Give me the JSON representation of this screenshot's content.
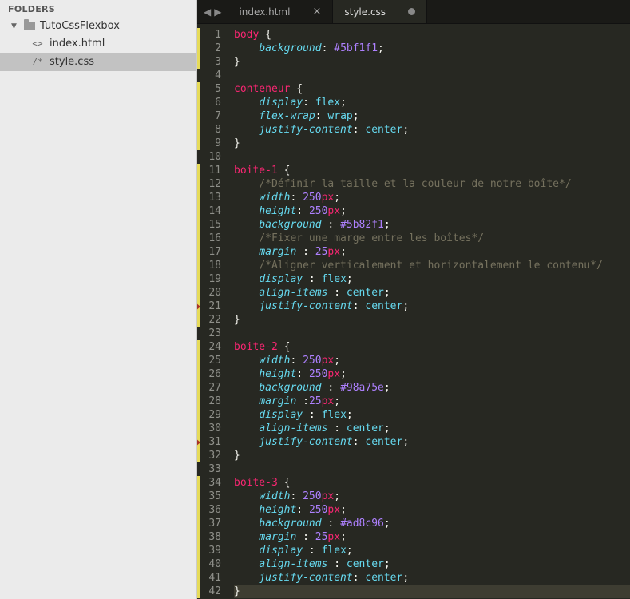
{
  "sidebar": {
    "header": "FOLDERS",
    "folder": "TutoCssFlexbox",
    "files": [
      {
        "icon": "<>",
        "name": "index.html",
        "selected": false
      },
      {
        "icon": "/*",
        "name": "style.css",
        "selected": true
      }
    ]
  },
  "tabs": [
    {
      "label": "index.html",
      "active": false,
      "dirty": false
    },
    {
      "label": "style.css",
      "active": true,
      "dirty": true
    }
  ],
  "code": {
    "lines": [
      {
        "n": 1,
        "m": true,
        "t": [
          [
            "sel",
            "body"
          ],
          [
            "punc",
            " {"
          ]
        ]
      },
      {
        "n": 2,
        "m": true,
        "t": [
          [
            "",
            "    "
          ],
          [
            "prop",
            "background"
          ],
          [
            "punc",
            ": "
          ],
          [
            "hex",
            "#5bf1f1"
          ],
          [
            "punc",
            ";"
          ]
        ]
      },
      {
        "n": 3,
        "m": true,
        "t": [
          [
            "punc",
            "}"
          ]
        ]
      },
      {
        "n": 4,
        "t": []
      },
      {
        "n": 5,
        "m": true,
        "t": [
          [
            "sel",
            "conteneur"
          ],
          [
            "punc",
            " {"
          ]
        ]
      },
      {
        "n": 6,
        "m": true,
        "t": [
          [
            "",
            "    "
          ],
          [
            "prop",
            "display"
          ],
          [
            "punc",
            ": "
          ],
          [
            "val",
            "flex"
          ],
          [
            "punc",
            ";"
          ]
        ]
      },
      {
        "n": 7,
        "m": true,
        "t": [
          [
            "",
            "    "
          ],
          [
            "prop",
            "flex-wrap"
          ],
          [
            "punc",
            ": "
          ],
          [
            "val",
            "wrap"
          ],
          [
            "punc",
            ";"
          ]
        ]
      },
      {
        "n": 8,
        "m": true,
        "t": [
          [
            "",
            "    "
          ],
          [
            "prop",
            "justify-content"
          ],
          [
            "punc",
            ": "
          ],
          [
            "val",
            "center"
          ],
          [
            "punc",
            ";"
          ]
        ]
      },
      {
        "n": 9,
        "m": true,
        "t": [
          [
            "punc",
            "}"
          ]
        ]
      },
      {
        "n": 10,
        "t": []
      },
      {
        "n": 11,
        "m": true,
        "t": [
          [
            "sel",
            "boite-1"
          ],
          [
            "punc",
            " {"
          ]
        ]
      },
      {
        "n": 12,
        "m": true,
        "t": [
          [
            "",
            "    "
          ],
          [
            "com",
            "/*Définir la taille et la couleur de notre boîte*/"
          ]
        ]
      },
      {
        "n": 13,
        "m": true,
        "t": [
          [
            "",
            "    "
          ],
          [
            "prop",
            "width"
          ],
          [
            "punc",
            ": "
          ],
          [
            "num",
            "250"
          ],
          [
            "unit",
            "px"
          ],
          [
            "punc",
            ";"
          ]
        ]
      },
      {
        "n": 14,
        "m": true,
        "t": [
          [
            "",
            "    "
          ],
          [
            "prop",
            "height"
          ],
          [
            "punc",
            ": "
          ],
          [
            "num",
            "250"
          ],
          [
            "unit",
            "px"
          ],
          [
            "punc",
            ";"
          ]
        ]
      },
      {
        "n": 15,
        "m": true,
        "t": [
          [
            "",
            "    "
          ],
          [
            "prop",
            "background"
          ],
          [
            "punc",
            " : "
          ],
          [
            "hex",
            "#5b82f1"
          ],
          [
            "punc",
            ";"
          ]
        ]
      },
      {
        "n": 16,
        "m": true,
        "t": [
          [
            "",
            "    "
          ],
          [
            "com",
            "/*Fixer une marge entre les boîtes*/"
          ]
        ]
      },
      {
        "n": 17,
        "m": true,
        "t": [
          [
            "",
            "    "
          ],
          [
            "prop",
            "margin"
          ],
          [
            "punc",
            " : "
          ],
          [
            "num",
            "25"
          ],
          [
            "unit",
            "px"
          ],
          [
            "punc",
            ";"
          ]
        ]
      },
      {
        "n": 18,
        "m": true,
        "t": [
          [
            "",
            "    "
          ],
          [
            "com",
            "/*Aligner verticalement et horizontalement le contenu*/"
          ]
        ]
      },
      {
        "n": 19,
        "m": true,
        "t": [
          [
            "",
            "    "
          ],
          [
            "prop",
            "display"
          ],
          [
            "punc",
            " : "
          ],
          [
            "val",
            "flex"
          ],
          [
            "punc",
            ";"
          ]
        ]
      },
      {
        "n": 20,
        "m": true,
        "t": [
          [
            "",
            "    "
          ],
          [
            "prop",
            "align-items"
          ],
          [
            "punc",
            " : "
          ],
          [
            "val",
            "center"
          ],
          [
            "punc",
            ";"
          ]
        ]
      },
      {
        "n": 21,
        "m": true,
        "f": true,
        "t": [
          [
            "",
            "    "
          ],
          [
            "prop",
            "justify-content"
          ],
          [
            "punc",
            ": "
          ],
          [
            "val",
            "center"
          ],
          [
            "punc",
            ";"
          ]
        ]
      },
      {
        "n": 22,
        "m": true,
        "t": [
          [
            "punc",
            "}"
          ]
        ]
      },
      {
        "n": 23,
        "t": []
      },
      {
        "n": 24,
        "m": true,
        "t": [
          [
            "sel",
            "boite-2"
          ],
          [
            "punc",
            " {"
          ]
        ]
      },
      {
        "n": 25,
        "m": true,
        "t": [
          [
            "",
            "    "
          ],
          [
            "prop",
            "width"
          ],
          [
            "punc",
            ": "
          ],
          [
            "num",
            "250"
          ],
          [
            "unit",
            "px"
          ],
          [
            "punc",
            ";"
          ]
        ]
      },
      {
        "n": 26,
        "m": true,
        "t": [
          [
            "",
            "    "
          ],
          [
            "prop",
            "height"
          ],
          [
            "punc",
            ": "
          ],
          [
            "num",
            "250"
          ],
          [
            "unit",
            "px"
          ],
          [
            "punc",
            ";"
          ]
        ]
      },
      {
        "n": 27,
        "m": true,
        "t": [
          [
            "",
            "    "
          ],
          [
            "prop",
            "background"
          ],
          [
            "punc",
            " : "
          ],
          [
            "hex",
            "#98a75e"
          ],
          [
            "punc",
            ";"
          ]
        ]
      },
      {
        "n": 28,
        "m": true,
        "t": [
          [
            "",
            "    "
          ],
          [
            "prop",
            "margin"
          ],
          [
            "punc",
            " :"
          ],
          [
            "num",
            "25"
          ],
          [
            "unit",
            "px"
          ],
          [
            "punc",
            ";"
          ]
        ]
      },
      {
        "n": 29,
        "m": true,
        "t": [
          [
            "",
            "    "
          ],
          [
            "prop",
            "display"
          ],
          [
            "punc",
            " : "
          ],
          [
            "val",
            "flex"
          ],
          [
            "punc",
            ";"
          ]
        ]
      },
      {
        "n": 30,
        "m": true,
        "t": [
          [
            "",
            "    "
          ],
          [
            "prop",
            "align-items"
          ],
          [
            "punc",
            " : "
          ],
          [
            "val",
            "center"
          ],
          [
            "punc",
            ";"
          ]
        ]
      },
      {
        "n": 31,
        "m": true,
        "f": true,
        "t": [
          [
            "",
            "    "
          ],
          [
            "prop",
            "justify-content"
          ],
          [
            "punc",
            ": "
          ],
          [
            "val",
            "center"
          ],
          [
            "punc",
            ";"
          ]
        ]
      },
      {
        "n": 32,
        "m": true,
        "t": [
          [
            "punc",
            "}"
          ]
        ]
      },
      {
        "n": 33,
        "t": []
      },
      {
        "n": 34,
        "m": true,
        "t": [
          [
            "sel",
            "boite-3"
          ],
          [
            "punc",
            " {"
          ]
        ]
      },
      {
        "n": 35,
        "m": true,
        "t": [
          [
            "",
            "    "
          ],
          [
            "prop",
            "width"
          ],
          [
            "punc",
            ": "
          ],
          [
            "num",
            "250"
          ],
          [
            "unit",
            "px"
          ],
          [
            "punc",
            ";"
          ]
        ]
      },
      {
        "n": 36,
        "m": true,
        "t": [
          [
            "",
            "    "
          ],
          [
            "prop",
            "height"
          ],
          [
            "punc",
            ": "
          ],
          [
            "num",
            "250"
          ],
          [
            "unit",
            "px"
          ],
          [
            "punc",
            ";"
          ]
        ]
      },
      {
        "n": 37,
        "m": true,
        "t": [
          [
            "",
            "    "
          ],
          [
            "prop",
            "background"
          ],
          [
            "punc",
            " : "
          ],
          [
            "hex",
            "#ad8c96"
          ],
          [
            "punc",
            ";"
          ]
        ]
      },
      {
        "n": 38,
        "m": true,
        "t": [
          [
            "",
            "    "
          ],
          [
            "prop",
            "margin"
          ],
          [
            "punc",
            " : "
          ],
          [
            "num",
            "25"
          ],
          [
            "unit",
            "px"
          ],
          [
            "punc",
            ";"
          ]
        ]
      },
      {
        "n": 39,
        "m": true,
        "t": [
          [
            "",
            "    "
          ],
          [
            "prop",
            "display"
          ],
          [
            "punc",
            " : "
          ],
          [
            "val",
            "flex"
          ],
          [
            "punc",
            ";"
          ]
        ]
      },
      {
        "n": 40,
        "m": true,
        "t": [
          [
            "",
            "    "
          ],
          [
            "prop",
            "align-items"
          ],
          [
            "punc",
            " : "
          ],
          [
            "val",
            "center"
          ],
          [
            "punc",
            ";"
          ]
        ]
      },
      {
        "n": 41,
        "m": true,
        "t": [
          [
            "",
            "    "
          ],
          [
            "prop",
            "justify-content"
          ],
          [
            "punc",
            ": "
          ],
          [
            "val",
            "center"
          ],
          [
            "punc",
            ";"
          ]
        ]
      },
      {
        "n": 42,
        "m": true,
        "hl": true,
        "t": [
          [
            "punc",
            "}"
          ]
        ]
      }
    ]
  }
}
